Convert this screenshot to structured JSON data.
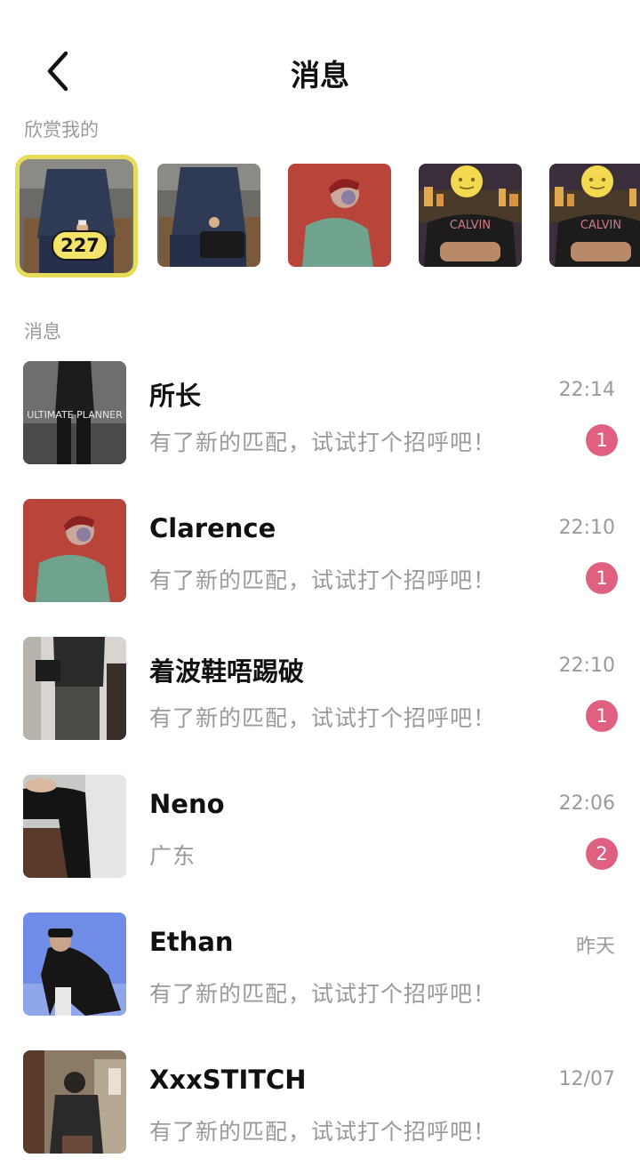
{
  "header": {
    "title": "消息",
    "back_icon": "chevron-left-icon"
  },
  "admirers": {
    "label": "欣赏我的",
    "count": "227",
    "accent_color": "#e7dc5a",
    "photo_texts": [
      "CALVIN",
      "CALVIN"
    ]
  },
  "messages": {
    "label": "消息",
    "badge_color": "#e06082",
    "items": [
      {
        "name": "所长",
        "time": "22:14",
        "preview": "有了新的匹配，试试打个招呼吧！",
        "unread": "1",
        "photo_text": "ULTIMATE PLANNER"
      },
      {
        "name": "Clarence",
        "time": "22:10",
        "preview": "有了新的匹配，试试打个招呼吧！",
        "unread": "1"
      },
      {
        "name": "着波鞋唔踢破",
        "time": "22:10",
        "preview": "有了新的匹配，试试打个招呼吧！",
        "unread": "1"
      },
      {
        "name": "Neno",
        "time": "22:06",
        "preview": "广东",
        "unread": "2"
      },
      {
        "name": "Ethan",
        "time": "昨天",
        "preview": "有了新的匹配，试试打个招呼吧！",
        "unread": null
      },
      {
        "name": "XxxSTITCH",
        "time": "12/07",
        "preview": "有了新的匹配，试试打个招呼吧！",
        "unread": null
      }
    ]
  }
}
